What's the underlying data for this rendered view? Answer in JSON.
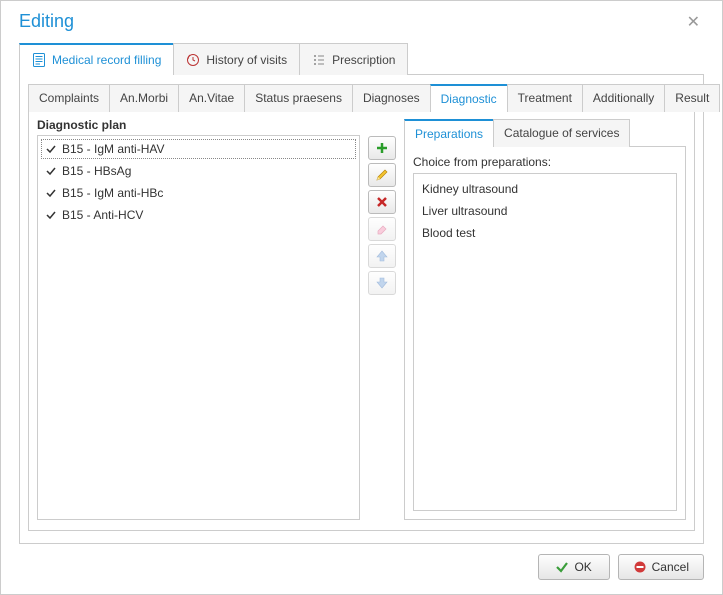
{
  "dialog": {
    "title": "Editing"
  },
  "topTabs": {
    "medical": "Medical record filling",
    "history": "History of visits",
    "prescription": "Prescription"
  },
  "subTabs": {
    "complaints": "Complaints",
    "anMorbi": "An.Morbi",
    "anVitae": "An.Vitae",
    "status": "Status praesens",
    "diagnoses": "Diagnoses",
    "diagnostic": "Diagnostic",
    "treatment": "Treatment",
    "additionally": "Additionally",
    "result": "Result"
  },
  "plan": {
    "title": "Diagnostic plan",
    "items": [
      "B15 - IgM anti-HAV",
      "B15 - HBsAg",
      "B15 - IgM anti-HBc",
      "B15 - Anti-HCV"
    ]
  },
  "prepTabs": {
    "preparations": "Preparations",
    "catalogue": "Catalogue of services"
  },
  "prep": {
    "label": "Choice from preparations:",
    "items": [
      "Kidney ultrasound",
      "Liver ultrasound",
      "Blood test"
    ]
  },
  "buttons": {
    "ok": "OK",
    "cancel": "Cancel"
  }
}
